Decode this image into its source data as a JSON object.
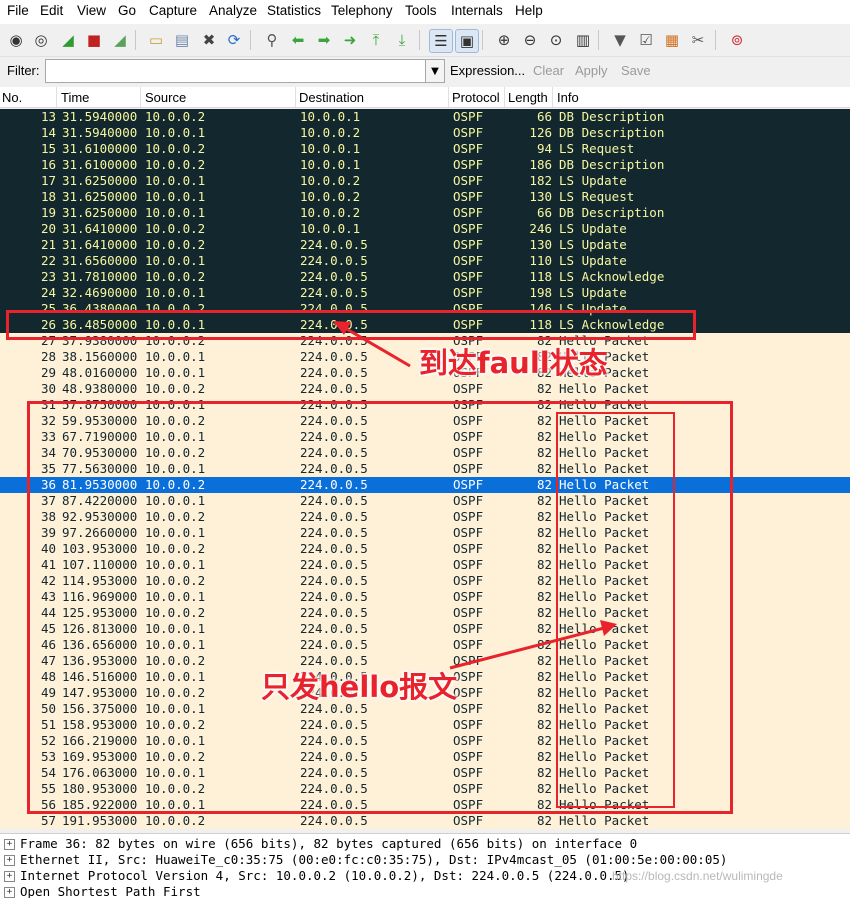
{
  "menu": [
    "File",
    "Edit",
    "View",
    "Go",
    "Capture",
    "Analyze",
    "Statistics",
    "Telephony",
    "Tools",
    "Internals",
    "Help"
  ],
  "toolbar_icons": [
    "interface-list-icon",
    "capture-options-icon",
    "start-capture-icon",
    "stop-capture-icon",
    "restart-capture-icon",
    "open-file-icon",
    "save-file-icon",
    "close-file-icon",
    "reload-icon",
    "find-packet-icon",
    "go-back-icon",
    "go-forward-icon",
    "go-to-packet-icon",
    "go-first-icon",
    "go-last-icon",
    "colorize-icon",
    "auto-scroll-icon",
    "zoom-in-icon",
    "zoom-out-icon",
    "normal-size-icon",
    "resize-columns-icon",
    "capture-filters-icon",
    "display-filters-icon",
    "coloring-rules-icon",
    "preferences-icon",
    "help-icon"
  ],
  "filter": {
    "label": "Filter:",
    "value": "",
    "expression": "Expression...",
    "clear": "Clear",
    "apply": "Apply",
    "save": "Save"
  },
  "columns": [
    "No.",
    "Time",
    "Source",
    "Destination",
    "Protocol",
    "Length",
    "Info"
  ],
  "colors": {
    "dark_row_bg": "#12272e",
    "dark_row_fg": "#f7f7a0",
    "light_row_bg": "#fff0d8",
    "selected_bg": "#0b6fd9",
    "annotation": "#e8232b"
  },
  "packets": [
    {
      "no": "13",
      "time": "31.5940000",
      "src": "10.0.0.2",
      "dst": "10.0.0.1",
      "proto": "OSPF",
      "len": "66",
      "info": "DB Description",
      "style": "dark"
    },
    {
      "no": "14",
      "time": "31.5940000",
      "src": "10.0.0.1",
      "dst": "10.0.0.2",
      "proto": "OSPF",
      "len": "126",
      "info": "DB Description",
      "style": "dark"
    },
    {
      "no": "15",
      "time": "31.6100000",
      "src": "10.0.0.2",
      "dst": "10.0.0.1",
      "proto": "OSPF",
      "len": "94",
      "info": "LS Request",
      "style": "dark"
    },
    {
      "no": "16",
      "time": "31.6100000",
      "src": "10.0.0.2",
      "dst": "10.0.0.1",
      "proto": "OSPF",
      "len": "186",
      "info": "DB Description",
      "style": "dark"
    },
    {
      "no": "17",
      "time": "31.6250000",
      "src": "10.0.0.1",
      "dst": "10.0.0.2",
      "proto": "OSPF",
      "len": "182",
      "info": "LS Update",
      "style": "dark"
    },
    {
      "no": "18",
      "time": "31.6250000",
      "src": "10.0.0.1",
      "dst": "10.0.0.2",
      "proto": "OSPF",
      "len": "130",
      "info": "LS Request",
      "style": "dark"
    },
    {
      "no": "19",
      "time": "31.6250000",
      "src": "10.0.0.1",
      "dst": "10.0.0.2",
      "proto": "OSPF",
      "len": "66",
      "info": "DB Description",
      "style": "dark"
    },
    {
      "no": "20",
      "time": "31.6410000",
      "src": "10.0.0.2",
      "dst": "10.0.0.1",
      "proto": "OSPF",
      "len": "246",
      "info": "LS Update",
      "style": "dark"
    },
    {
      "no": "21",
      "time": "31.6410000",
      "src": "10.0.0.2",
      "dst": "224.0.0.5",
      "proto": "OSPF",
      "len": "130",
      "info": "LS Update",
      "style": "dark"
    },
    {
      "no": "22",
      "time": "31.6560000",
      "src": "10.0.0.1",
      "dst": "224.0.0.5",
      "proto": "OSPF",
      "len": "110",
      "info": "LS Update",
      "style": "dark"
    },
    {
      "no": "23",
      "time": "31.7810000",
      "src": "10.0.0.2",
      "dst": "224.0.0.5",
      "proto": "OSPF",
      "len": "118",
      "info": "LS Acknowledge",
      "style": "dark"
    },
    {
      "no": "24",
      "time": "32.4690000",
      "src": "10.0.0.1",
      "dst": "224.0.0.5",
      "proto": "OSPF",
      "len": "198",
      "info": "LS Update",
      "style": "dark"
    },
    {
      "no": "25",
      "time": "36.4380000",
      "src": "10.0.0.2",
      "dst": "224.0.0.5",
      "proto": "OSPF",
      "len": "146",
      "info": "LS Update",
      "style": "dark"
    },
    {
      "no": "26",
      "time": "36.4850000",
      "src": "10.0.0.1",
      "dst": "224.0.0.5",
      "proto": "OSPF",
      "len": "118",
      "info": "LS Acknowledge",
      "style": "dark"
    },
    {
      "no": "27",
      "time": "37.9380000",
      "src": "10.0.0.2",
      "dst": "224.0.0.5",
      "proto": "OSPF",
      "len": "82",
      "info": "Hello Packet",
      "style": "light"
    },
    {
      "no": "28",
      "time": "38.1560000",
      "src": "10.0.0.1",
      "dst": "224.0.0.5",
      "proto": "OSPF",
      "len": "82",
      "info": "Hello Packet",
      "style": "light"
    },
    {
      "no": "29",
      "time": "48.0160000",
      "src": "10.0.0.1",
      "dst": "224.0.0.5",
      "proto": "OSPF",
      "len": "82",
      "info": "Hello Packet",
      "style": "light"
    },
    {
      "no": "30",
      "time": "48.9380000",
      "src": "10.0.0.2",
      "dst": "224.0.0.5",
      "proto": "OSPF",
      "len": "82",
      "info": "Hello Packet",
      "style": "light"
    },
    {
      "no": "31",
      "time": "57.8750000",
      "src": "10.0.0.1",
      "dst": "224.0.0.5",
      "proto": "OSPF",
      "len": "82",
      "info": "Hello Packet",
      "style": "light"
    },
    {
      "no": "32",
      "time": "59.9530000",
      "src": "10.0.0.2",
      "dst": "224.0.0.5",
      "proto": "OSPF",
      "len": "82",
      "info": "Hello Packet",
      "style": "light"
    },
    {
      "no": "33",
      "time": "67.7190000",
      "src": "10.0.0.1",
      "dst": "224.0.0.5",
      "proto": "OSPF",
      "len": "82",
      "info": "Hello Packet",
      "style": "light"
    },
    {
      "no": "34",
      "time": "70.9530000",
      "src": "10.0.0.2",
      "dst": "224.0.0.5",
      "proto": "OSPF",
      "len": "82",
      "info": "Hello Packet",
      "style": "light"
    },
    {
      "no": "35",
      "time": "77.5630000",
      "src": "10.0.0.1",
      "dst": "224.0.0.5",
      "proto": "OSPF",
      "len": "82",
      "info": "Hello Packet",
      "style": "light"
    },
    {
      "no": "36",
      "time": "81.9530000",
      "src": "10.0.0.2",
      "dst": "224.0.0.5",
      "proto": "OSPF",
      "len": "82",
      "info": "Hello Packet",
      "style": "sel"
    },
    {
      "no": "37",
      "time": "87.4220000",
      "src": "10.0.0.1",
      "dst": "224.0.0.5",
      "proto": "OSPF",
      "len": "82",
      "info": "Hello Packet",
      "style": "light"
    },
    {
      "no": "38",
      "time": "92.9530000",
      "src": "10.0.0.2",
      "dst": "224.0.0.5",
      "proto": "OSPF",
      "len": "82",
      "info": "Hello Packet",
      "style": "light"
    },
    {
      "no": "39",
      "time": "97.2660000",
      "src": "10.0.0.1",
      "dst": "224.0.0.5",
      "proto": "OSPF",
      "len": "82",
      "info": "Hello Packet",
      "style": "light"
    },
    {
      "no": "40",
      "time": "103.953000",
      "src": "10.0.0.2",
      "dst": "224.0.0.5",
      "proto": "OSPF",
      "len": "82",
      "info": "Hello Packet",
      "style": "light"
    },
    {
      "no": "41",
      "time": "107.110000",
      "src": "10.0.0.1",
      "dst": "224.0.0.5",
      "proto": "OSPF",
      "len": "82",
      "info": "Hello Packet",
      "style": "light"
    },
    {
      "no": "42",
      "time": "114.953000",
      "src": "10.0.0.2",
      "dst": "224.0.0.5",
      "proto": "OSPF",
      "len": "82",
      "info": "Hello Packet",
      "style": "light"
    },
    {
      "no": "43",
      "time": "116.969000",
      "src": "10.0.0.1",
      "dst": "224.0.0.5",
      "proto": "OSPF",
      "len": "82",
      "info": "Hello Packet",
      "style": "light"
    },
    {
      "no": "44",
      "time": "125.953000",
      "src": "10.0.0.2",
      "dst": "224.0.0.5",
      "proto": "OSPF",
      "len": "82",
      "info": "Hello Packet",
      "style": "light"
    },
    {
      "no": "45",
      "time": "126.813000",
      "src": "10.0.0.1",
      "dst": "224.0.0.5",
      "proto": "OSPF",
      "len": "82",
      "info": "Hello Packet",
      "style": "light"
    },
    {
      "no": "46",
      "time": "136.656000",
      "src": "10.0.0.1",
      "dst": "224.0.0.5",
      "proto": "OSPF",
      "len": "82",
      "info": "Hello Packet",
      "style": "light"
    },
    {
      "no": "47",
      "time": "136.953000",
      "src": "10.0.0.2",
      "dst": "224.0.0.5",
      "proto": "OSPF",
      "len": "82",
      "info": "Hello Packet",
      "style": "light"
    },
    {
      "no": "48",
      "time": "146.516000",
      "src": "10.0.0.1",
      "dst": "224.0.0.5",
      "proto": "OSPF",
      "len": "82",
      "info": "Hello Packet",
      "style": "light"
    },
    {
      "no": "49",
      "time": "147.953000",
      "src": "10.0.0.2",
      "dst": "224.0.0.5",
      "proto": "OSPF",
      "len": "82",
      "info": "Hello Packet",
      "style": "light"
    },
    {
      "no": "50",
      "time": "156.375000",
      "src": "10.0.0.1",
      "dst": "224.0.0.5",
      "proto": "OSPF",
      "len": "82",
      "info": "Hello Packet",
      "style": "light"
    },
    {
      "no": "51",
      "time": "158.953000",
      "src": "10.0.0.2",
      "dst": "224.0.0.5",
      "proto": "OSPF",
      "len": "82",
      "info": "Hello Packet",
      "style": "light"
    },
    {
      "no": "52",
      "time": "166.219000",
      "src": "10.0.0.1",
      "dst": "224.0.0.5",
      "proto": "OSPF",
      "len": "82",
      "info": "Hello Packet",
      "style": "light"
    },
    {
      "no": "53",
      "time": "169.953000",
      "src": "10.0.0.2",
      "dst": "224.0.0.5",
      "proto": "OSPF",
      "len": "82",
      "info": "Hello Packet",
      "style": "light"
    },
    {
      "no": "54",
      "time": "176.063000",
      "src": "10.0.0.1",
      "dst": "224.0.0.5",
      "proto": "OSPF",
      "len": "82",
      "info": "Hello Packet",
      "style": "light"
    },
    {
      "no": "55",
      "time": "180.953000",
      "src": "10.0.0.2",
      "dst": "224.0.0.5",
      "proto": "OSPF",
      "len": "82",
      "info": "Hello Packet",
      "style": "light"
    },
    {
      "no": "56",
      "time": "185.922000",
      "src": "10.0.0.1",
      "dst": "224.0.0.5",
      "proto": "OSPF",
      "len": "82",
      "info": "Hello Packet",
      "style": "light"
    },
    {
      "no": "57",
      "time": "191.953000",
      "src": "10.0.0.2",
      "dst": "224.0.0.5",
      "proto": "OSPF",
      "len": "82",
      "info": "Hello Packet",
      "style": "light"
    }
  ],
  "details": [
    "Frame 36: 82 bytes on wire (656 bits), 82 bytes captured (656 bits) on interface 0",
    "Ethernet II, Src: HuaweiTe_c0:35:75 (00:e0:fc:c0:35:75), Dst: IPv4mcast_05 (01:00:5e:00:00:05)",
    "Internet Protocol Version 4, Src: 10.0.0.2 (10.0.0.2), Dst: 224.0.0.5 (224.0.0.5)",
    "Open Shortest Path First"
  ],
  "annotations": {
    "full_state": "到达faull状态",
    "hello_only": "只发hello报文"
  },
  "watermark": "https://blog.csdn.net/wulimingde"
}
